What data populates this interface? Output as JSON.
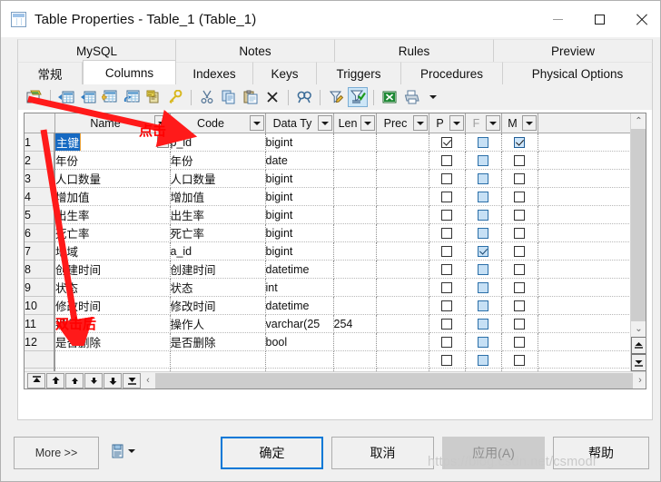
{
  "window": {
    "title": "Table Properties - Table_1 (Table_1)",
    "icon": "table-icon",
    "minimize": "minimize-icon",
    "maximize": "maximize-icon",
    "close": "close-icon"
  },
  "tabs": {
    "top_row": [
      {
        "label": "MySQL",
        "active": false
      },
      {
        "label": "Notes",
        "active": false
      },
      {
        "label": "Rules",
        "active": false
      },
      {
        "label": "Preview",
        "active": false
      }
    ],
    "bottom_row": [
      {
        "label": "常规",
        "active": false
      },
      {
        "label": "Columns",
        "active": true
      },
      {
        "label": "Indexes",
        "active": false
      },
      {
        "label": "Keys",
        "active": false
      },
      {
        "label": "Triggers",
        "active": false
      },
      {
        "label": "Procedures",
        "active": false
      },
      {
        "label": "Physical Options",
        "active": false
      }
    ]
  },
  "toolbar": {
    "items": [
      {
        "name": "edit-table-icon",
        "active": false
      },
      {
        "name": "insert-column-before-icon",
        "active": false
      },
      {
        "name": "insert-column-after-icon",
        "active": false
      },
      {
        "name": "add-column-icon",
        "active": false
      },
      {
        "name": "refresh-column-icon",
        "active": false
      },
      {
        "name": "properties-icon",
        "active": false
      },
      {
        "name": "key-icon",
        "active": false
      },
      {
        "name": "cut-icon",
        "active": false
      },
      {
        "name": "copy-icon",
        "active": false
      },
      {
        "name": "paste-icon",
        "active": false
      },
      {
        "name": "delete-icon",
        "active": false
      },
      {
        "name": "find-icon",
        "active": false
      },
      {
        "name": "filter-edit-icon",
        "active": false
      },
      {
        "name": "filter-apply-icon",
        "active": true
      },
      {
        "name": "excel-export-icon",
        "active": false
      },
      {
        "name": "print-icon",
        "active": false
      },
      {
        "name": "chevron-down-icon",
        "active": false
      }
    ]
  },
  "grid": {
    "columns": [
      {
        "key": "rownum",
        "label": "",
        "has_dropdown": false
      },
      {
        "key": "name",
        "label": "Name",
        "has_dropdown": true
      },
      {
        "key": "code",
        "label": "Code",
        "has_dropdown": true
      },
      {
        "key": "datatype",
        "label": "Data Ty",
        "has_dropdown": true
      },
      {
        "key": "len",
        "label": "Len",
        "has_dropdown": true
      },
      {
        "key": "prec",
        "label": "Prec",
        "has_dropdown": true
      },
      {
        "key": "p",
        "label": "P",
        "has_dropdown": true,
        "dim": false
      },
      {
        "key": "f",
        "label": "F",
        "has_dropdown": true,
        "dim": true
      },
      {
        "key": "m",
        "label": "M",
        "has_dropdown": true,
        "dim": false
      }
    ],
    "rows": [
      {
        "num": "1",
        "name": "主键",
        "code": "p_id",
        "datatype": "bigint",
        "len": "",
        "prec": "",
        "p": "checked",
        "f": "disabled",
        "m": "checked-highlight",
        "selected": true
      },
      {
        "num": "2",
        "name": "年份",
        "code": "年份",
        "datatype": "date",
        "len": "",
        "prec": "",
        "p": "unchecked",
        "f": "disabled",
        "m": "unchecked",
        "selected": false
      },
      {
        "num": "3",
        "name": "人口数量",
        "code": "人口数量",
        "datatype": "bigint",
        "len": "",
        "prec": "",
        "p": "unchecked",
        "f": "disabled",
        "m": "unchecked",
        "selected": false
      },
      {
        "num": "4",
        "name": "增加值",
        "code": "增加值",
        "datatype": "bigint",
        "len": "",
        "prec": "",
        "p": "unchecked",
        "f": "disabled",
        "m": "unchecked",
        "selected": false
      },
      {
        "num": "5",
        "name": "出生率",
        "code": "出生率",
        "datatype": "bigint",
        "len": "",
        "prec": "",
        "p": "unchecked",
        "f": "disabled",
        "m": "unchecked",
        "selected": false
      },
      {
        "num": "6",
        "name": "死亡率",
        "code": "死亡率",
        "datatype": "bigint",
        "len": "",
        "prec": "",
        "p": "unchecked",
        "f": "disabled",
        "m": "unchecked",
        "selected": false
      },
      {
        "num": "7",
        "name": "地域",
        "code": "a_id",
        "datatype": "bigint",
        "len": "",
        "prec": "",
        "p": "unchecked",
        "f": "disabled-checked",
        "m": "unchecked",
        "selected": false
      },
      {
        "num": "8",
        "name": "创建时间",
        "code": "创建时间",
        "datatype": "datetime",
        "len": "",
        "prec": "",
        "p": "unchecked",
        "f": "disabled",
        "m": "unchecked",
        "selected": false
      },
      {
        "num": "9",
        "name": "状态",
        "code": "状态",
        "datatype": "int",
        "len": "",
        "prec": "",
        "p": "unchecked",
        "f": "disabled",
        "m": "unchecked",
        "selected": false
      },
      {
        "num": "10",
        "name": "修改时间",
        "code": "修改时间",
        "datatype": "datetime",
        "len": "",
        "prec": "",
        "p": "unchecked",
        "f": "disabled",
        "m": "unchecked",
        "selected": false
      },
      {
        "num": "11",
        "name": "操作人",
        "code": "操作人",
        "datatype": "varchar(25",
        "len": "254",
        "prec": "",
        "p": "unchecked",
        "f": "disabled",
        "m": "unchecked",
        "selected": false
      },
      {
        "num": "12",
        "name": "是否删除",
        "code": "是否删除",
        "datatype": "bool",
        "len": "",
        "prec": "",
        "p": "unchecked",
        "f": "disabled",
        "m": "unchecked",
        "selected": false
      }
    ],
    "empty_rows": 3,
    "nav_buttons": [
      {
        "name": "nav-first-button",
        "glyph": "⤒"
      },
      {
        "name": "nav-page-up-button",
        "glyph": "⬆"
      },
      {
        "name": "nav-up-button",
        "glyph": "↑"
      },
      {
        "name": "nav-down-button",
        "glyph": "↓"
      },
      {
        "name": "nav-page-down-button",
        "glyph": "⬇"
      },
      {
        "name": "nav-last-button",
        "glyph": "⤓"
      }
    ],
    "vscroll": {
      "up": "scroll-up-icon",
      "down": "scroll-down-icon",
      "page_up": "scroll-page-up-icon",
      "page_down": "scroll-page-down-icon"
    },
    "hscroll": {
      "left": "scroll-left-icon",
      "right": "scroll-right-icon"
    }
  },
  "footer": {
    "more_label": "More >>",
    "save_icon": "save-profile-icon",
    "save_dropdown": "chevron-down-icon",
    "ok_label": "确定",
    "cancel_label": "取消",
    "apply_label": "应用(A)",
    "help_label": "帮助"
  },
  "annotations": [
    {
      "name": "annotation-click",
      "text": "点击",
      "color": "#ff0000"
    },
    {
      "name": "annotation-dblclick",
      "text": "双击后",
      "color": "#ff0000"
    }
  ],
  "watermark": {
    "text": "https://blog.csdn.net/csmodl"
  }
}
